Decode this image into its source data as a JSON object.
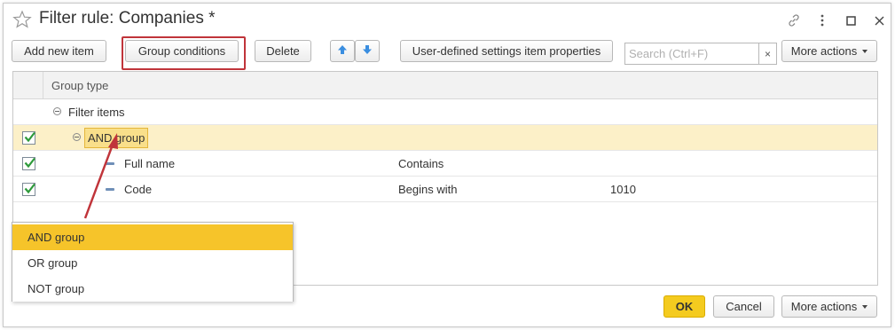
{
  "window": {
    "title": "Filter rule: Companies *"
  },
  "icons": {
    "favorite": "star-outline-icon",
    "link": "link-icon",
    "menu": "vertical-ellipsis-icon",
    "maximize": "maximize-icon",
    "close": "close-icon",
    "move_up": "arrow-up-icon",
    "move_down": "arrow-down-icon",
    "clear": "clear-icon"
  },
  "toolbar": {
    "add_new_item": "Add new item",
    "group_conditions": "Group conditions",
    "delete": "Delete",
    "user_settings": "User-defined settings item properties",
    "search_placeholder": "Search (Ctrl+F)",
    "clear_label": "×",
    "more_actions": "More actions"
  },
  "table": {
    "header": "Group type",
    "rows": [
      {
        "label": "Filter items",
        "condition": "",
        "value": ""
      },
      {
        "label": "AND group",
        "condition": "",
        "value": "",
        "checked": true,
        "selected": true
      },
      {
        "label": "Full name",
        "condition": "Contains",
        "value": "",
        "checked": true
      },
      {
        "label": "Code",
        "condition": "Begins with",
        "value": "1010",
        "checked": true
      }
    ]
  },
  "dropdown": {
    "items": [
      "AND group",
      "OR group",
      "NOT group"
    ],
    "active_index": 0
  },
  "footer": {
    "ok": "OK",
    "cancel": "Cancel",
    "more_actions": "More actions"
  },
  "colors": {
    "accent": "#f6c42a",
    "selected_row": "#fcf0c8",
    "callout": "#c0343a",
    "checkmark": "#2d9a3a",
    "arrow_icon": "#3a8ee0"
  }
}
